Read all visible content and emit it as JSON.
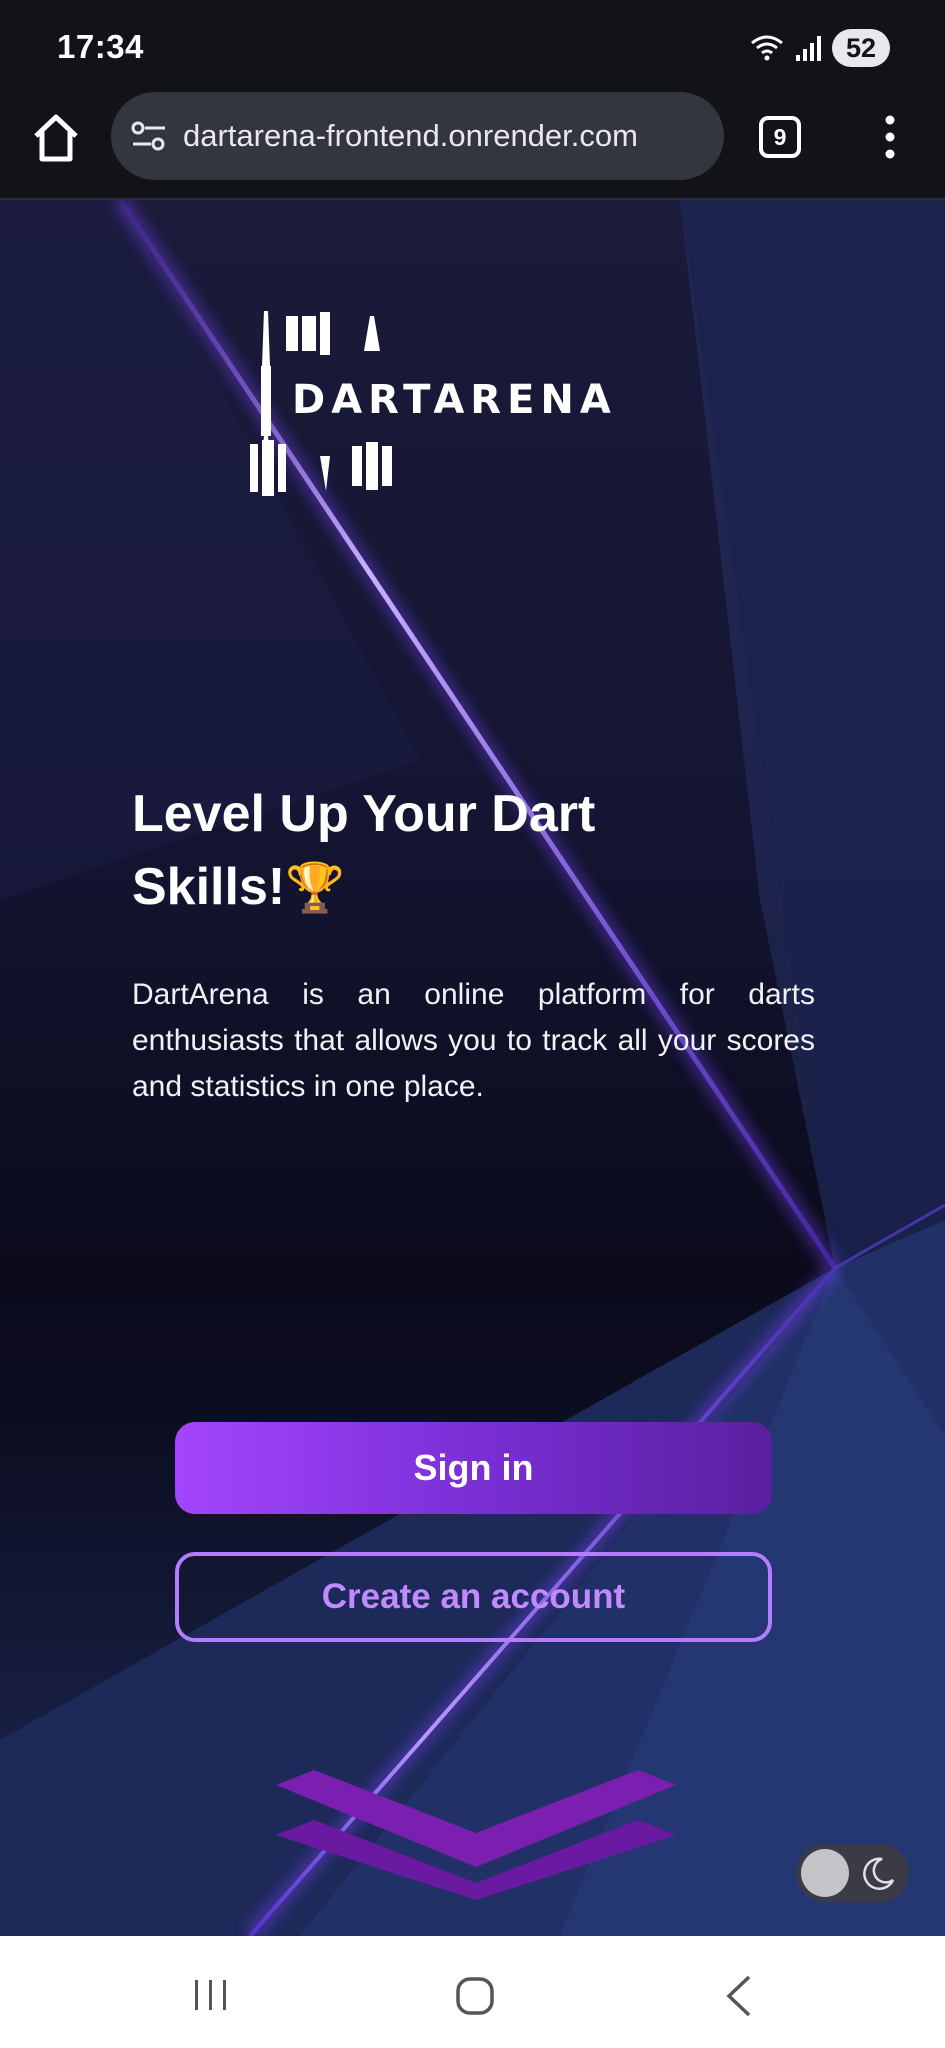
{
  "status_bar": {
    "time": "17:34",
    "battery": "52",
    "icons": [
      "wifi-icon",
      "signal-icon",
      "battery-icon"
    ]
  },
  "browser": {
    "url": "dartarena-frontend.onrender.com",
    "tab_count": "9",
    "icons": [
      "home-icon",
      "tune-icon",
      "tabs-icon",
      "more-vert-icon"
    ]
  },
  "hero": {
    "logo_text": "DARTARENA",
    "headline_line1": "Level Up Your Dart",
    "headline_line2": "Skills!",
    "headline_emoji": "🏆",
    "description": "DartArena is an online platform for darts enthusiasts that allows you to track all your scores and statistics in one place.",
    "signin_label": "Sign in",
    "create_account_label": "Create an account"
  },
  "theme_toggle": {
    "state": "light-off",
    "icon": "moon-icon"
  },
  "colors": {
    "accent_purple": "#a445ff",
    "accent_purple_dark": "#5a1f9f",
    "outline_purple": "#b57cff",
    "background_navy": "#141532"
  },
  "nav_bar": {
    "icons": [
      "recent-apps-icon",
      "home-nav-icon",
      "back-icon"
    ]
  }
}
